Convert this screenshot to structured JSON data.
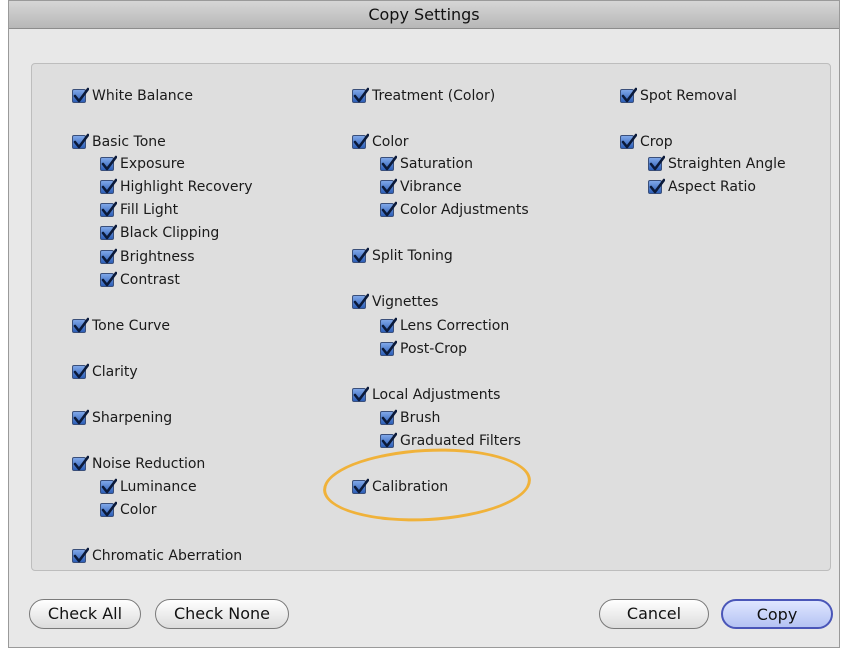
{
  "window": {
    "title": "Copy Settings"
  },
  "columns": [
    {
      "items": [
        {
          "label": "White Balance",
          "checked": true,
          "indent": 0
        },
        {
          "label": "Basic Tone",
          "checked": true,
          "indent": 0
        },
        {
          "label": "Exposure",
          "checked": true,
          "indent": 1
        },
        {
          "label": "Highlight Recovery",
          "checked": true,
          "indent": 1
        },
        {
          "label": "Fill Light",
          "checked": true,
          "indent": 1
        },
        {
          "label": "Black Clipping",
          "checked": true,
          "indent": 1
        },
        {
          "label": "Brightness",
          "checked": true,
          "indent": 1
        },
        {
          "label": "Contrast",
          "checked": true,
          "indent": 1
        },
        {
          "label": "Tone Curve",
          "checked": true,
          "indent": 0
        },
        {
          "label": "Clarity",
          "checked": true,
          "indent": 0
        },
        {
          "label": "Sharpening",
          "checked": true,
          "indent": 0
        },
        {
          "label": "Noise Reduction",
          "checked": true,
          "indent": 0
        },
        {
          "label": "Luminance",
          "checked": true,
          "indent": 1
        },
        {
          "label": "Color",
          "checked": true,
          "indent": 1
        },
        {
          "label": "Chromatic Aberration",
          "checked": true,
          "indent": 0
        }
      ]
    },
    {
      "items": [
        {
          "label": "Treatment (Color)",
          "checked": true,
          "indent": 0
        },
        {
          "label": "Color",
          "checked": true,
          "indent": 0
        },
        {
          "label": "Saturation",
          "checked": true,
          "indent": 1
        },
        {
          "label": "Vibrance",
          "checked": true,
          "indent": 1
        },
        {
          "label": "Color Adjustments",
          "checked": true,
          "indent": 1
        },
        {
          "label": "Split Toning",
          "checked": true,
          "indent": 0
        },
        {
          "label": "Vignettes",
          "checked": true,
          "indent": 0
        },
        {
          "label": "Lens Correction",
          "checked": true,
          "indent": 1
        },
        {
          "label": "Post-Crop",
          "checked": true,
          "indent": 1
        },
        {
          "label": "Local Adjustments",
          "checked": true,
          "indent": 0
        },
        {
          "label": "Brush",
          "checked": true,
          "indent": 1
        },
        {
          "label": "Graduated Filters",
          "checked": true,
          "indent": 1
        },
        {
          "label": "Calibration",
          "checked": true,
          "indent": 0,
          "highlighted": true
        }
      ]
    },
    {
      "items": [
        {
          "label": "Spot Removal",
          "checked": true,
          "indent": 0
        },
        {
          "label": "Crop",
          "checked": true,
          "indent": 0
        },
        {
          "label": "Straighten Angle",
          "checked": true,
          "indent": 1
        },
        {
          "label": "Aspect Ratio",
          "checked": true,
          "indent": 1
        }
      ]
    }
  ],
  "buttons": {
    "check_all": "Check All",
    "check_none": "Check None",
    "cancel": "Cancel",
    "copy": "Copy"
  },
  "colors": {
    "checkbox_fill": "#2d5fb8",
    "highlight_ring": "#f0b23a",
    "default_button_border": "#4a56b8"
  }
}
